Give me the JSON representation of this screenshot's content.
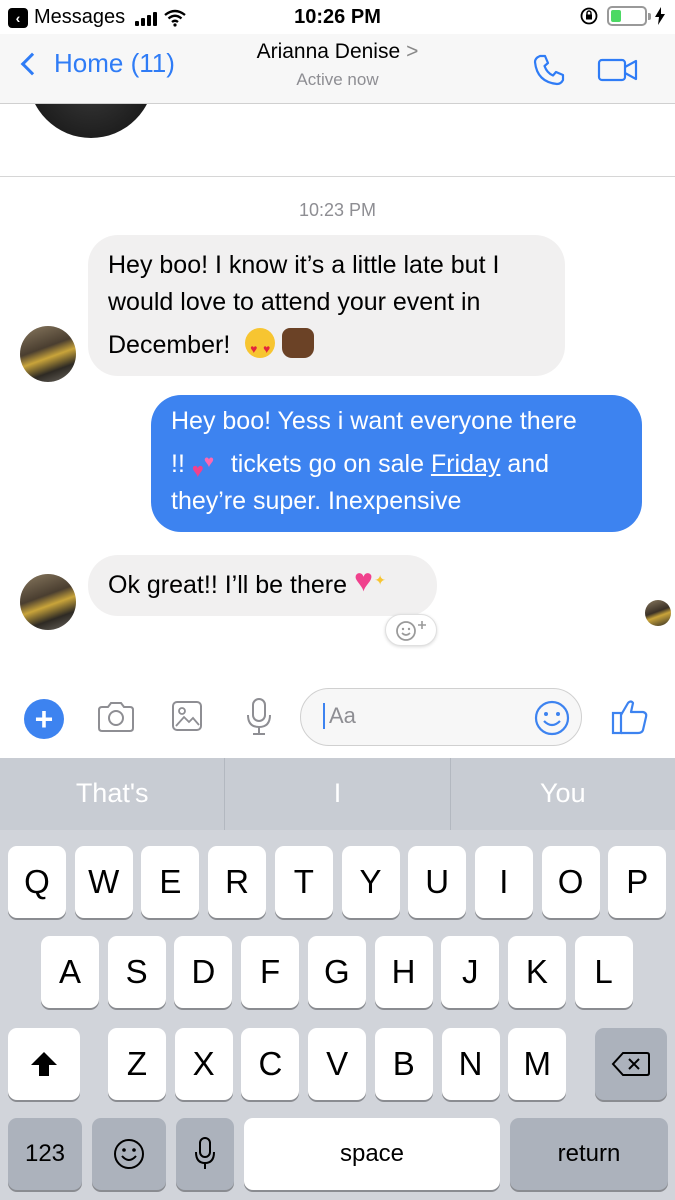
{
  "status_bar": {
    "back_app": "Messages",
    "time": "10:26 PM"
  },
  "nav": {
    "back_label": "Home (11)",
    "contact_name": "Arianna Denise",
    "chevron": ">",
    "subtitle": "Active now"
  },
  "chat": {
    "timestamp": "10:23 PM",
    "messages": [
      {
        "direction": "incoming",
        "lines": [
          "Hey boo! I know it’s a little late but I",
          "would love to attend your event in",
          "December!"
        ],
        "emoji": [
          "smiling-face-with-heart-eyes",
          "raising-hands"
        ]
      },
      {
        "direction": "outgoing",
        "line1": "Hey boo! Yess i want everyone there",
        "line2_pre": "!!",
        "line2_mid": "tickets go on sale",
        "line2_link": "Friday",
        "line2_post": "and",
        "line3": "they’re super. Inexpensive",
        "emoji": [
          "two-hearts"
        ]
      },
      {
        "direction": "incoming",
        "text": "Ok great!! I’ll be there",
        "emoji": [
          "sparkling-heart"
        ]
      }
    ]
  },
  "composer": {
    "placeholder": "Aa",
    "icons": [
      "plus-icon",
      "camera-icon",
      "photo-icon",
      "microphone-icon",
      "emoji-icon",
      "thumbs-up-icon"
    ]
  },
  "keyboard": {
    "suggestions": [
      "That's",
      "I",
      "You"
    ],
    "row1": [
      "Q",
      "W",
      "E",
      "R",
      "T",
      "Y",
      "U",
      "I",
      "O",
      "P"
    ],
    "row2": [
      "A",
      "S",
      "D",
      "F",
      "G",
      "H",
      "J",
      "K",
      "L"
    ],
    "row3": [
      "Z",
      "X",
      "C",
      "V",
      "B",
      "N",
      "M"
    ],
    "numbers_label": "123",
    "space_label": "space",
    "return_label": "return"
  },
  "colors": {
    "accent": "#3d83f0",
    "incoming_bubble": "#f1f0f0",
    "keyboard_bg": "#d1d4da"
  }
}
